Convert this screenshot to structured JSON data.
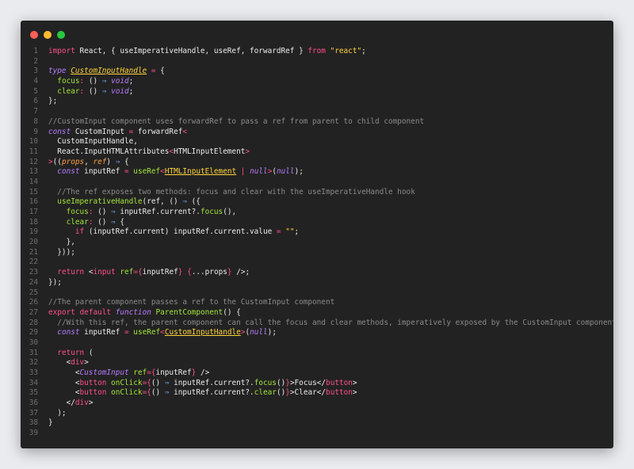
{
  "window": {
    "traffic_lights": [
      "close",
      "minimize",
      "maximize"
    ],
    "colors": {
      "close": "#ff5f57",
      "minimize": "#febc2e",
      "maximize": "#28c840",
      "background": "#222222"
    }
  },
  "code": {
    "language": "tsx",
    "lines": [
      {
        "n": "1",
        "tokens": [
          [
            "kw",
            "import"
          ],
          [
            "pl",
            " React, { useImperativeHandle, useRef, forwardRef } "
          ],
          [
            "kw",
            "from"
          ],
          [
            "pl",
            " "
          ],
          [
            "str",
            "\"react\""
          ],
          [
            "pl",
            ";"
          ]
        ]
      },
      {
        "n": "2",
        "tokens": []
      },
      {
        "n": "3",
        "tokens": [
          [
            "kwi",
            "type"
          ],
          [
            "pl",
            " "
          ],
          [
            "ty",
            "CustomInputHandle"
          ],
          [
            "pl",
            " "
          ],
          [
            "op",
            "="
          ],
          [
            "pl",
            " {"
          ]
        ]
      },
      {
        "n": "4",
        "tokens": [
          [
            "pl",
            "  "
          ],
          [
            "prop",
            "focus"
          ],
          [
            "op",
            ":"
          ],
          [
            "pl",
            " () "
          ],
          [
            "arr",
            "⇒"
          ],
          [
            "pl",
            " "
          ],
          [
            "lit",
            "void"
          ],
          [
            "pl",
            ";"
          ]
        ]
      },
      {
        "n": "5",
        "tokens": [
          [
            "pl",
            "  "
          ],
          [
            "prop",
            "clear"
          ],
          [
            "op",
            ":"
          ],
          [
            "pl",
            " () "
          ],
          [
            "arr",
            "⇒"
          ],
          [
            "pl",
            " "
          ],
          [
            "lit",
            "void"
          ],
          [
            "pl",
            ";"
          ]
        ]
      },
      {
        "n": "6",
        "tokens": [
          [
            "pl",
            "};"
          ]
        ]
      },
      {
        "n": "7",
        "tokens": []
      },
      {
        "n": "8",
        "tokens": [
          [
            "cm",
            "//CustomInput component uses forwardRef to pass a ref from parent to child component"
          ]
        ]
      },
      {
        "n": "9",
        "tokens": [
          [
            "kwi",
            "const"
          ],
          [
            "pl",
            " CustomInput "
          ],
          [
            "op",
            "="
          ],
          [
            "pl",
            " forwardRef"
          ],
          [
            "op",
            "<"
          ]
        ]
      },
      {
        "n": "10",
        "tokens": [
          [
            "pl",
            "  CustomInputHandle,"
          ]
        ]
      },
      {
        "n": "11",
        "tokens": [
          [
            "pl",
            "  React.InputHTMLAttributes"
          ],
          [
            "op",
            "<"
          ],
          [
            "pl",
            "HTMLInputElement"
          ],
          [
            "op",
            ">"
          ]
        ]
      },
      {
        "n": "12",
        "tokens": [
          [
            "op",
            ">"
          ],
          [
            "pl",
            "(("
          ],
          [
            "pa",
            "props"
          ],
          [
            "pl",
            ", "
          ],
          [
            "pa",
            "ref"
          ],
          [
            "pl",
            ") "
          ],
          [
            "arr",
            "⇒"
          ],
          [
            "pl",
            " {"
          ]
        ]
      },
      {
        "n": "13",
        "tokens": [
          [
            "pl",
            "  "
          ],
          [
            "kwi",
            "const"
          ],
          [
            "pl",
            " inputRef "
          ],
          [
            "op",
            "="
          ],
          [
            "pl",
            " "
          ],
          [
            "fn",
            "useRef"
          ],
          [
            "op",
            "<"
          ],
          [
            "tyc",
            "HTMLInputElement"
          ],
          [
            "pl",
            " "
          ],
          [
            "op",
            "|"
          ],
          [
            "pl",
            " "
          ],
          [
            "lit",
            "null"
          ],
          [
            "op",
            ">"
          ],
          [
            "pl",
            "("
          ],
          [
            "lit",
            "null"
          ],
          [
            "pl",
            ");"
          ]
        ]
      },
      {
        "n": "14",
        "tokens": []
      },
      {
        "n": "15",
        "tokens": [
          [
            "pl",
            "  "
          ],
          [
            "cm",
            "//The ref exposes two methods: focus and clear with the useImperativeHandle hook"
          ]
        ]
      },
      {
        "n": "16",
        "tokens": [
          [
            "pl",
            "  "
          ],
          [
            "fn",
            "useImperativeHandle"
          ],
          [
            "pl",
            "(ref, () "
          ],
          [
            "arr",
            "⇒"
          ],
          [
            "pl",
            " ({"
          ]
        ]
      },
      {
        "n": "17",
        "tokens": [
          [
            "pl",
            "    "
          ],
          [
            "prop",
            "focus"
          ],
          [
            "op",
            ":"
          ],
          [
            "pl",
            " () "
          ],
          [
            "arr",
            "⇒"
          ],
          [
            "pl",
            " inputRef.current?."
          ],
          [
            "fn",
            "focus"
          ],
          [
            "pl",
            "(),"
          ]
        ]
      },
      {
        "n": "18",
        "tokens": [
          [
            "pl",
            "    "
          ],
          [
            "prop",
            "clear"
          ],
          [
            "op",
            ":"
          ],
          [
            "pl",
            " () "
          ],
          [
            "arr",
            "⇒"
          ],
          [
            "pl",
            " {"
          ]
        ]
      },
      {
        "n": "19",
        "tokens": [
          [
            "pl",
            "      "
          ],
          [
            "kw",
            "if"
          ],
          [
            "pl",
            " (inputRef.current) inputRef.current.value "
          ],
          [
            "op",
            "="
          ],
          [
            "pl",
            " "
          ],
          [
            "str",
            "\"\""
          ],
          [
            "pl",
            ";"
          ]
        ]
      },
      {
        "n": "20",
        "tokens": [
          [
            "pl",
            "    },"
          ]
        ]
      },
      {
        "n": "21",
        "tokens": [
          [
            "pl",
            "  }));"
          ]
        ]
      },
      {
        "n": "22",
        "tokens": []
      },
      {
        "n": "23",
        "tokens": [
          [
            "pl",
            "  "
          ],
          [
            "kw",
            "return"
          ],
          [
            "pl",
            " <"
          ],
          [
            "tag",
            "input"
          ],
          [
            "pl",
            " "
          ],
          [
            "attr",
            "ref"
          ],
          [
            "op",
            "={"
          ],
          [
            "pl",
            "inputRef"
          ],
          [
            "op",
            "}"
          ],
          [
            "pl",
            " "
          ],
          [
            "op",
            "{"
          ],
          [
            "pl",
            "..."
          ],
          [
            "pl",
            "props"
          ],
          [
            "op",
            "}"
          ],
          [
            "pl",
            " />;"
          ]
        ]
      },
      {
        "n": "24",
        "tokens": [
          [
            "pl",
            "});"
          ]
        ]
      },
      {
        "n": "25",
        "tokens": []
      },
      {
        "n": "26",
        "tokens": [
          [
            "cm",
            "//The parent component passes a ref to the CustomInput component"
          ]
        ]
      },
      {
        "n": "27",
        "tokens": [
          [
            "kw",
            "export"
          ],
          [
            "pl",
            " "
          ],
          [
            "kw",
            "default"
          ],
          [
            "pl",
            " "
          ],
          [
            "kwi",
            "function"
          ],
          [
            "pl",
            " "
          ],
          [
            "fn",
            "ParentComponent"
          ],
          [
            "pl",
            "() {"
          ]
        ]
      },
      {
        "n": "28",
        "tokens": [
          [
            "pl",
            "  "
          ],
          [
            "cm",
            "//With this ref, the parent component can call the focus and clear methods, imperatively exposed by the CustomInput component"
          ]
        ]
      },
      {
        "n": "29",
        "tokens": [
          [
            "pl",
            "  "
          ],
          [
            "kwi",
            "const"
          ],
          [
            "pl",
            " inputRef "
          ],
          [
            "op",
            "="
          ],
          [
            "pl",
            " "
          ],
          [
            "fn",
            "useRef"
          ],
          [
            "op",
            "<"
          ],
          [
            "tyc",
            "CustomInputHandle"
          ],
          [
            "op",
            ">"
          ],
          [
            "pl",
            "("
          ],
          [
            "lit",
            "null"
          ],
          [
            "pl",
            ");"
          ]
        ]
      },
      {
        "n": "30",
        "tokens": []
      },
      {
        "n": "31",
        "tokens": [
          [
            "pl",
            "  "
          ],
          [
            "kw",
            "return"
          ],
          [
            "pl",
            " ("
          ]
        ]
      },
      {
        "n": "32",
        "tokens": [
          [
            "pl",
            "    <"
          ],
          [
            "tag",
            "div"
          ],
          [
            "pl",
            ">"
          ]
        ]
      },
      {
        "n": "33",
        "tokens": [
          [
            "pl",
            "      <"
          ],
          [
            "kwi",
            "CustomInput"
          ],
          [
            "pl",
            " "
          ],
          [
            "attr",
            "ref"
          ],
          [
            "op",
            "={"
          ],
          [
            "pl",
            "inputRef"
          ],
          [
            "op",
            "}"
          ],
          [
            "pl",
            " />"
          ]
        ]
      },
      {
        "n": "34",
        "tokens": [
          [
            "pl",
            "      <"
          ],
          [
            "tag",
            "button"
          ],
          [
            "pl",
            " "
          ],
          [
            "attr",
            "onClick"
          ],
          [
            "op",
            "={"
          ],
          [
            "pl",
            "() "
          ],
          [
            "arr",
            "⇒"
          ],
          [
            "pl",
            " inputRef.current?."
          ],
          [
            "fn",
            "focus"
          ],
          [
            "pl",
            "()"
          ],
          [
            "op",
            "}"
          ],
          [
            "pl",
            ">Focus</"
          ],
          [
            "tag",
            "button"
          ],
          [
            "pl",
            ">"
          ]
        ]
      },
      {
        "n": "35",
        "tokens": [
          [
            "pl",
            "      <"
          ],
          [
            "tag",
            "button"
          ],
          [
            "pl",
            " "
          ],
          [
            "attr",
            "onClick"
          ],
          [
            "op",
            "={"
          ],
          [
            "pl",
            "() "
          ],
          [
            "arr",
            "⇒"
          ],
          [
            "pl",
            " inputRef.current?."
          ],
          [
            "fn",
            "clear"
          ],
          [
            "pl",
            "()"
          ],
          [
            "op",
            "}"
          ],
          [
            "pl",
            ">Clear</"
          ],
          [
            "tag",
            "button"
          ],
          [
            "pl",
            ">"
          ]
        ]
      },
      {
        "n": "36",
        "tokens": [
          [
            "pl",
            "    </"
          ],
          [
            "tag",
            "div"
          ],
          [
            "pl",
            ">"
          ]
        ]
      },
      {
        "n": "37",
        "tokens": [
          [
            "pl",
            "  );"
          ]
        ]
      },
      {
        "n": "38",
        "tokens": [
          [
            "pl",
            "}"
          ]
        ]
      },
      {
        "n": "39",
        "tokens": []
      }
    ]
  }
}
